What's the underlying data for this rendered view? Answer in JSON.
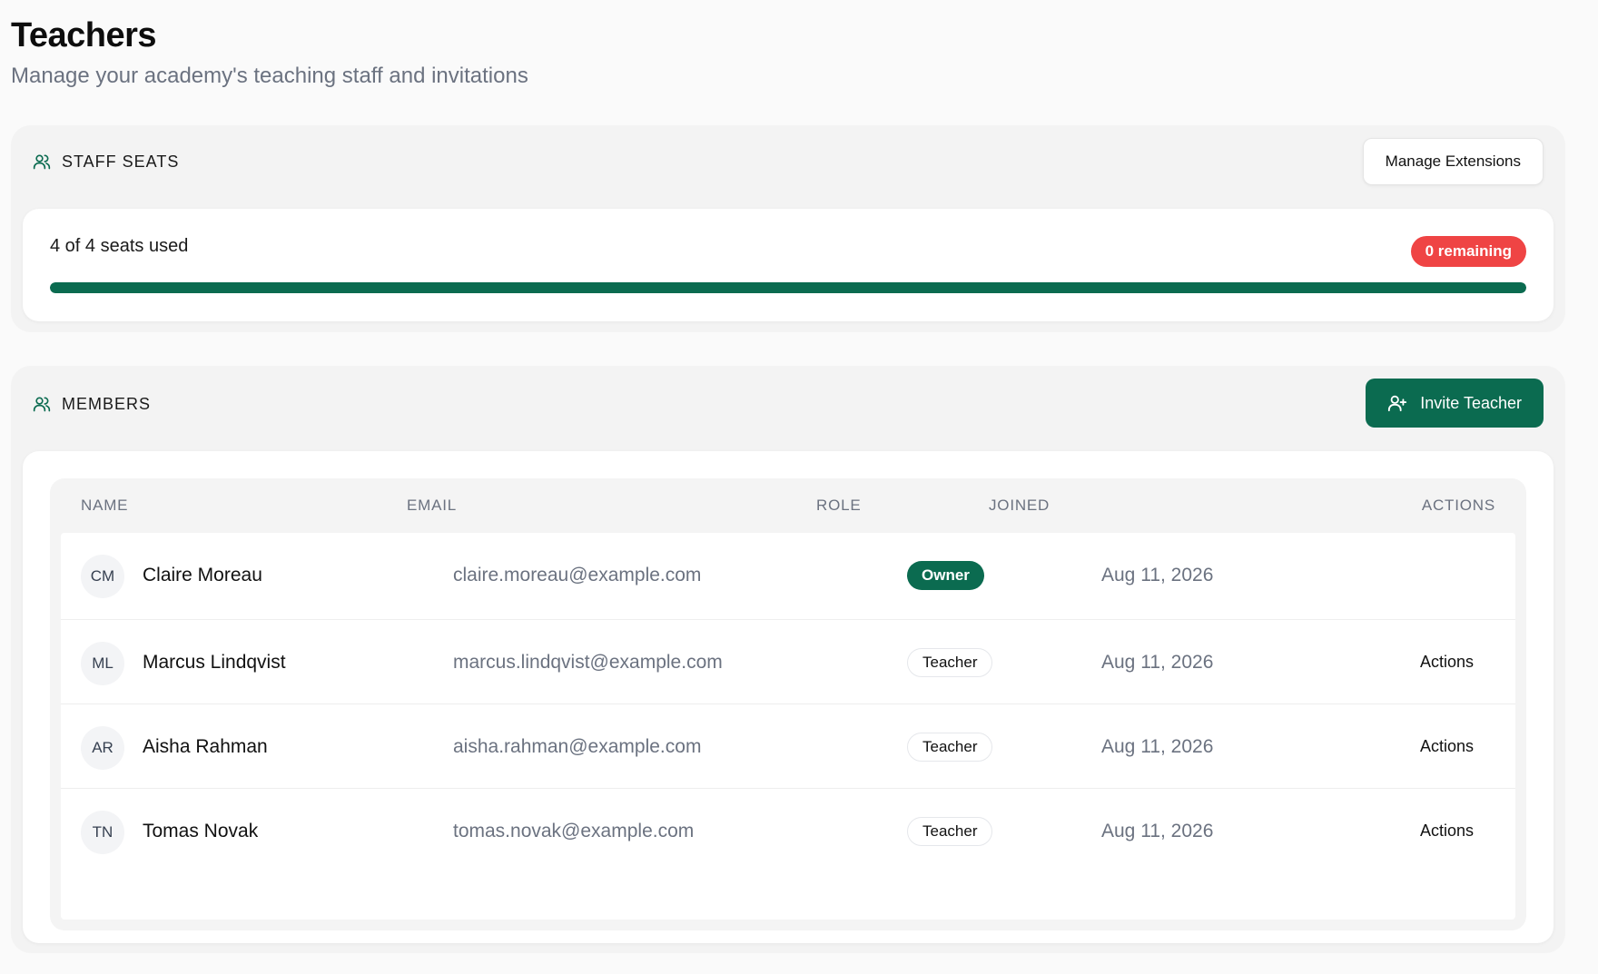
{
  "page": {
    "title": "Teachers",
    "subtitle": "Manage your academy's teaching staff and invitations"
  },
  "seats": {
    "label": "STAFF SEATS",
    "manage_button": "Manage Extensions",
    "used_text": "4 of 4 seats used",
    "remaining_badge": "0 remaining",
    "used": 4,
    "total": 4,
    "progress_fraction": 1.0
  },
  "members": {
    "label": "MEMBERS",
    "invite_button": "Invite Teacher",
    "columns": {
      "name": "NAME",
      "email": "EMAIL",
      "role": "ROLE",
      "joined": "JOINED",
      "actions": "ACTIONS"
    },
    "rows": [
      {
        "initials": "CM",
        "name": "Claire Moreau",
        "email": "claire.moreau@example.com",
        "role": "Owner",
        "joined": "Aug 11, 2026",
        "actions": ""
      },
      {
        "initials": "ML",
        "name": "Marcus Lindqvist",
        "email": "marcus.lindqvist@example.com",
        "role": "Teacher",
        "joined": "Aug 11, 2026",
        "actions": "Actions"
      },
      {
        "initials": "AR",
        "name": "Aisha Rahman",
        "email": "aisha.rahman@example.com",
        "role": "Teacher",
        "joined": "Aug 11, 2026",
        "actions": "Actions"
      },
      {
        "initials": "TN",
        "name": "Tomas Novak",
        "email": "tomas.novak@example.com",
        "role": "Teacher",
        "joined": "Aug 11, 2026",
        "actions": "Actions"
      }
    ]
  },
  "colors": {
    "accent": "#0b6b50",
    "danger": "#ef4444"
  },
  "icons": {
    "section_icon": "users-icon",
    "invite_icon": "user-plus-icon"
  }
}
